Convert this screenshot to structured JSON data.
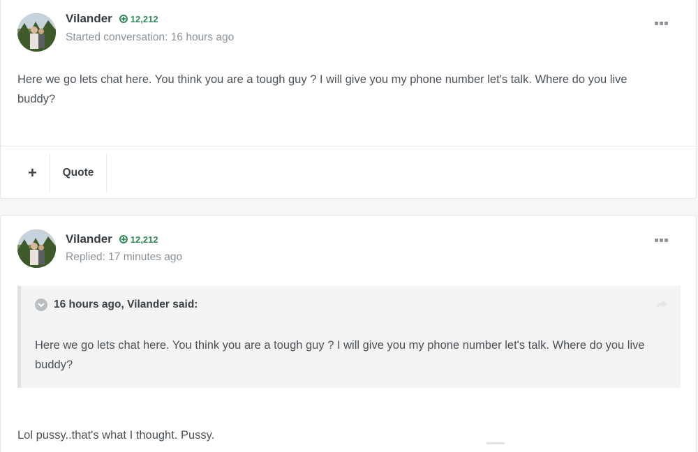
{
  "posts": [
    {
      "author": "Vilander",
      "reputation": "12,212",
      "meta": "Started conversation: 16 hours ago",
      "body": "Here we go lets chat here. You think you are a tough guy ? I will give you my phone number let's talk. Where do you live buddy?",
      "actions": {
        "plus_label": "+",
        "quote_label": "Quote"
      }
    },
    {
      "author": "Vilander",
      "reputation": "12,212",
      "meta": "Replied: 17 minutes ago",
      "quote": {
        "citation": "16 hours ago, Vilander said:",
        "body": "Here we go lets chat here. You think you are a tough guy ? I will give you my phone number let's talk. Where do you live buddy?"
      },
      "body": "Lol pussy..that's what I thought. Pussy."
    }
  ],
  "colors": {
    "reputation": "#2e8a57",
    "text": "#4a5157",
    "muted": "#8a9299",
    "quote_bg": "#f3f3f3"
  },
  "icons": {
    "reputation": "plus-circle-icon",
    "menu": "ellipsis-icon",
    "quote_toggle": "chevron-down-circle-icon",
    "share": "share-arrow-icon"
  }
}
